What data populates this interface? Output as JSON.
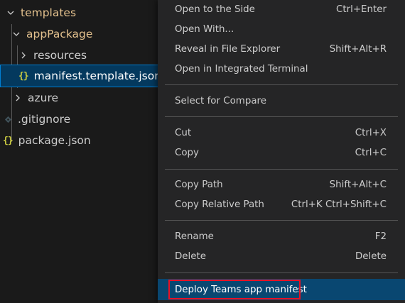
{
  "explorer": {
    "items": [
      {
        "label": "templates",
        "icon": "chevron-down-icon"
      },
      {
        "label": "appPackage",
        "icon": "chevron-down-icon"
      },
      {
        "label": "resources",
        "icon": "chevron-right-icon"
      },
      {
        "label": "manifest.template.json",
        "icon": "json-file-icon",
        "glyph": "{}"
      },
      {
        "label": "azure",
        "icon": "chevron-right-icon"
      },
      {
        "label": ".gitignore",
        "icon": "git-file-icon"
      },
      {
        "label": "package.json",
        "icon": "json-file-icon",
        "glyph": "{}"
      }
    ]
  },
  "context_menu": {
    "items": [
      {
        "label": "Open to the Side",
        "shortcut": "Ctrl+Enter"
      },
      {
        "label": "Open With...",
        "shortcut": ""
      },
      {
        "label": "Reveal in File Explorer",
        "shortcut": "Shift+Alt+R"
      },
      {
        "label": "Open in Integrated Terminal",
        "shortcut": ""
      },
      {
        "label": "Select for Compare",
        "shortcut": ""
      },
      {
        "label": "Cut",
        "shortcut": "Ctrl+X"
      },
      {
        "label": "Copy",
        "shortcut": "Ctrl+C"
      },
      {
        "label": "Copy Path",
        "shortcut": "Shift+Alt+C"
      },
      {
        "label": "Copy Relative Path",
        "shortcut": "Ctrl+K Ctrl+Shift+C"
      },
      {
        "label": "Rename",
        "shortcut": "F2"
      },
      {
        "label": "Delete",
        "shortcut": "Delete"
      },
      {
        "label": "Deploy Teams app manifest",
        "shortcut": ""
      }
    ]
  },
  "colors": {
    "folder_highlight": "#e2c08d",
    "selection_bg": "#04395e",
    "menu_active_bg": "#094771",
    "callout_border": "#e81123",
    "json_icon": "#cbcb41"
  }
}
